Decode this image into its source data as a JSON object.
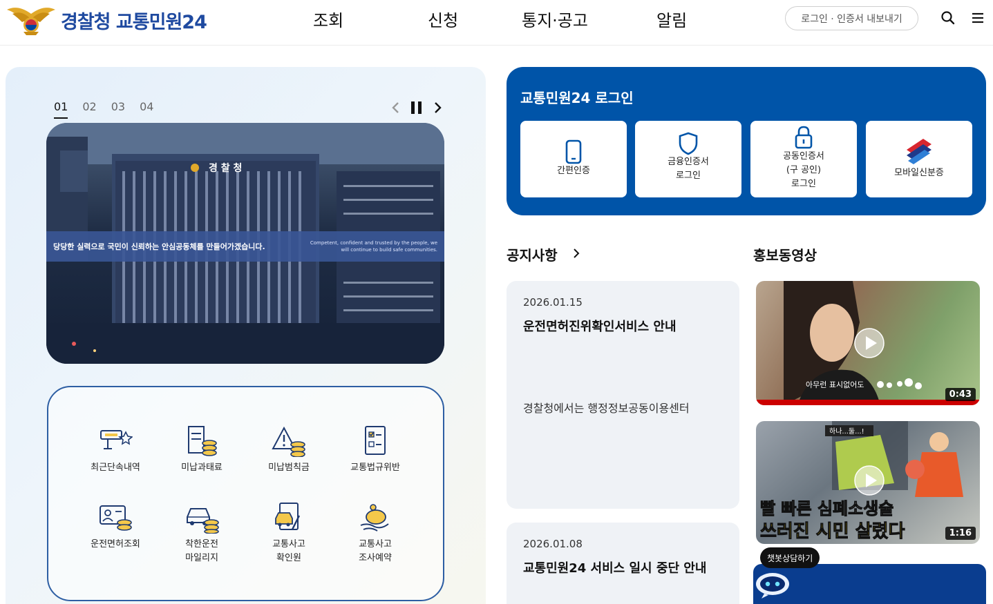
{
  "header": {
    "logo_text": "경찰청 교통민원24",
    "nav": [
      "조회",
      "신청",
      "통지·공고",
      "알림"
    ],
    "login_pill": "로그인 · 인증서 내보내기",
    "search_icon": "search-icon",
    "menu_icon": "hamburger-menu-icon"
  },
  "slider": {
    "tabs": [
      "01",
      "02",
      "03",
      "04"
    ],
    "active_tab": "01",
    "banner_ko": "당당한 실력으로 국민이 신뢰하는 안심공동체를 만들어가겠습니다.",
    "banner_en": "Competent, confident and trusted by the people, we will continue to build safe communities.",
    "building_sign": "경 찰 청"
  },
  "quick_menu": [
    {
      "label": "최근단속내역",
      "icon": "camera-speed-icon"
    },
    {
      "label": "미납과태료",
      "icon": "receipt-coins-icon"
    },
    {
      "label": "미납범칙금",
      "icon": "warning-coins-icon"
    },
    {
      "label": "교통법규위반",
      "icon": "document-check-icon"
    },
    {
      "label": "운전면허조회",
      "icon": "license-card-icon"
    },
    {
      "label": "착한운전\n마일리지",
      "icon": "car-coins-icon"
    },
    {
      "label": "교통사고\n확인원",
      "icon": "accident-doc-icon"
    },
    {
      "label": "교통사고\n조사예약",
      "icon": "piggy-bank-icon"
    }
  ],
  "login_card": {
    "title": "교통민원24 로그인",
    "options": [
      {
        "label": "간편인증",
        "icon": "smartphone-icon"
      },
      {
        "label": "금융인증서\n로그인",
        "icon": "shield-icon"
      },
      {
        "label": "공동인증서\n(구 공인)\n로그인",
        "icon": "lock-icon"
      },
      {
        "label": "모바일신분증",
        "icon": "mobile-id-icon"
      }
    ]
  },
  "notices": {
    "title": "공지사항",
    "items": [
      {
        "date": "2026.01.15",
        "title": "운전면허진위확인서비스 안내",
        "body": "경찰청에서는 행정정보공동이용센터"
      },
      {
        "date": "2026.01.08",
        "title": "교통민원24 서비스 일시 중단 안내",
        "body": ""
      }
    ]
  },
  "videos": {
    "title": "홍보동영상",
    "items": [
      {
        "duration": "0:43",
        "caption": "아무런 표시없어도"
      },
      {
        "duration": "1:16",
        "caption_top": "빨 빠른 심폐소생술",
        "caption_bottom": "쓰러진 시민 살렸다",
        "badge": "하나...둘...!"
      }
    ]
  },
  "chatbot": {
    "label": "챗봇상담하기"
  },
  "colors": {
    "brand_blue": "#0054a8",
    "logo_blue": "#1f4aa0",
    "border_blue": "#2d5ea3"
  }
}
